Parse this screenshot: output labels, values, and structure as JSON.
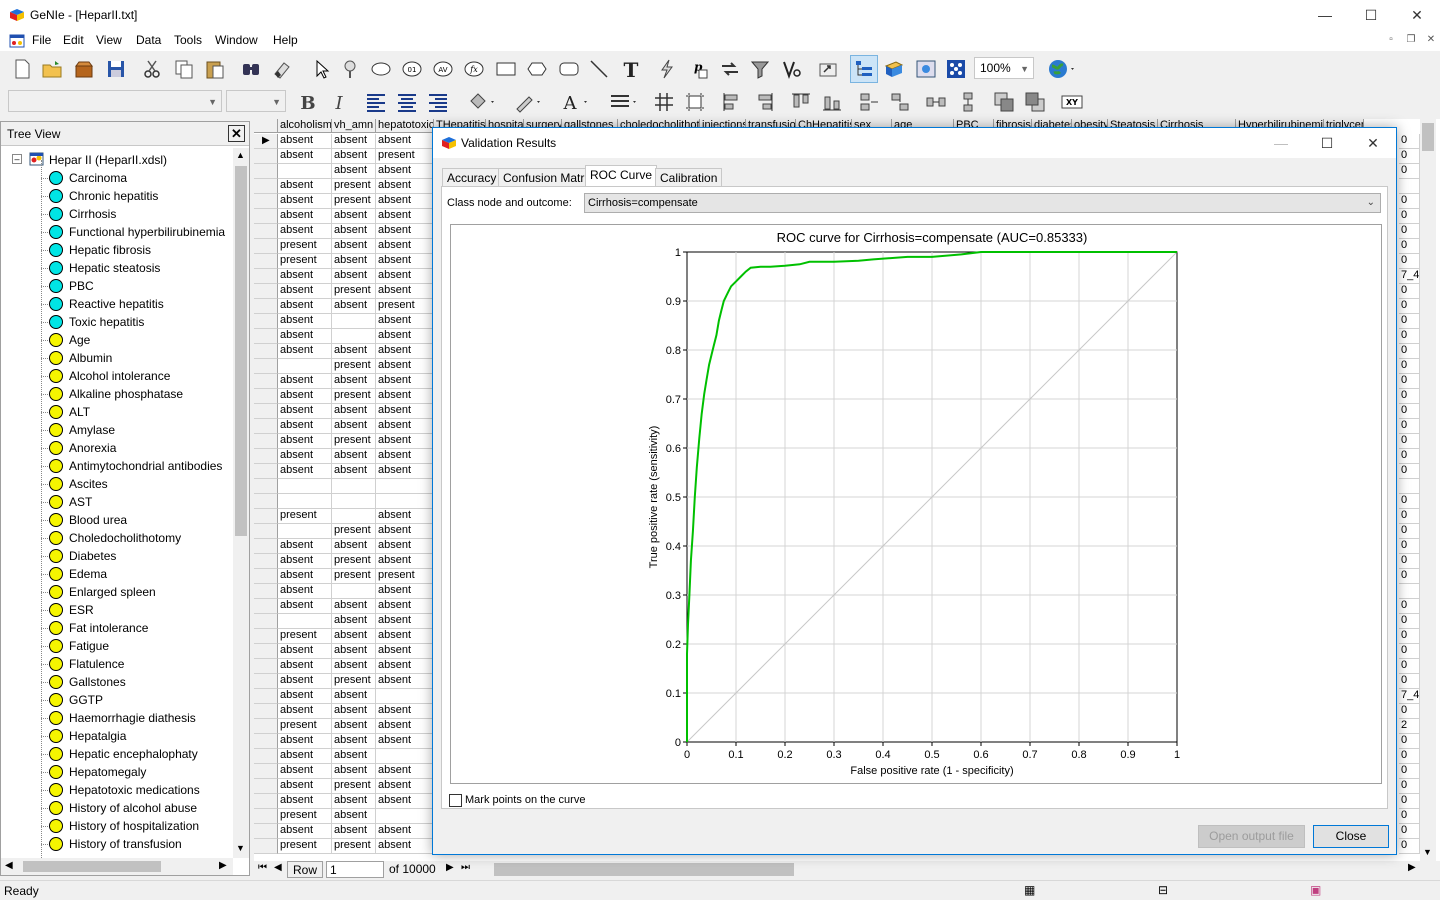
{
  "app": {
    "title": "GeNIe - [HeparII.txt]",
    "menu": [
      "File",
      "Edit",
      "View",
      "Data",
      "Tools",
      "Window",
      "Help"
    ],
    "zoom": "100%",
    "status": "Ready"
  },
  "tree": {
    "title": "Tree View",
    "root": "Hepar II (HeparII.xdsl)",
    "nodes": [
      {
        "label": "Carcinoma",
        "color": "#00e5e5"
      },
      {
        "label": "Chronic hepatitis",
        "color": "#00e5e5"
      },
      {
        "label": "Cirrhosis",
        "color": "#00e5e5"
      },
      {
        "label": "Functional hyperbilirubinemia",
        "color": "#00e5e5"
      },
      {
        "label": "Hepatic fibrosis",
        "color": "#00e5e5"
      },
      {
        "label": "Hepatic steatosis",
        "color": "#00e5e5"
      },
      {
        "label": "PBC",
        "color": "#00e5e5"
      },
      {
        "label": "Reactive hepatitis",
        "color": "#00e5e5"
      },
      {
        "label": "Toxic hepatitis",
        "color": "#00e5e5"
      },
      {
        "label": "Age",
        "color": "#f5f500"
      },
      {
        "label": "Albumin",
        "color": "#f5f500"
      },
      {
        "label": "Alcohol intolerance",
        "color": "#f5f500"
      },
      {
        "label": "Alkaline phosphatase",
        "color": "#f5f500"
      },
      {
        "label": "ALT",
        "color": "#f5f500"
      },
      {
        "label": "Amylase",
        "color": "#f5f500"
      },
      {
        "label": "Anorexia",
        "color": "#f5f500"
      },
      {
        "label": "Antimytochondrial antibodies",
        "color": "#f5f500"
      },
      {
        "label": "Ascites",
        "color": "#f5f500"
      },
      {
        "label": "AST",
        "color": "#f5f500"
      },
      {
        "label": "Blood urea",
        "color": "#f5f500"
      },
      {
        "label": "Choledocholithotomy",
        "color": "#f5f500"
      },
      {
        "label": "Diabetes",
        "color": "#f5f500"
      },
      {
        "label": "Edema",
        "color": "#f5f500"
      },
      {
        "label": "Enlarged spleen",
        "color": "#f5f500"
      },
      {
        "label": "ESR",
        "color": "#f5f500"
      },
      {
        "label": "Fat intolerance",
        "color": "#f5f500"
      },
      {
        "label": "Fatigue",
        "color": "#f5f500"
      },
      {
        "label": "Flatulence",
        "color": "#f5f500"
      },
      {
        "label": "Gallstones",
        "color": "#f5f500"
      },
      {
        "label": "GGTP",
        "color": "#f5f500"
      },
      {
        "label": "Haemorrhagie diathesis",
        "color": "#f5f500"
      },
      {
        "label": "Hepatalgia",
        "color": "#f5f500"
      },
      {
        "label": "Hepatic encephalophaty",
        "color": "#f5f500"
      },
      {
        "label": "Hepatomegaly",
        "color": "#f5f500"
      },
      {
        "label": "Hepatotoxic medications",
        "color": "#f5f500"
      },
      {
        "label": "History of alcohol abuse",
        "color": "#f5f500"
      },
      {
        "label": "History of hospitalization",
        "color": "#f5f500"
      },
      {
        "label": "History of transfusion",
        "color": "#f5f500"
      }
    ]
  },
  "grid": {
    "columns": [
      "alcoholism",
      "vh_amn",
      "hepatotoxic",
      "THepatitis",
      "hospital",
      "surgery",
      "gallstones",
      "choledocholithotomy",
      "injections",
      "transfusion",
      "ChHepatitis",
      "sex",
      "age",
      "PBC",
      "fibrosis",
      "diabetes",
      "obesity",
      "Steatosis",
      "Cirrhosis",
      "Hyperbilirubinemia",
      "triglyceri"
    ],
    "rows": [
      [
        "absent",
        "absent",
        "absent",
        "0"
      ],
      [
        "absent",
        "absent",
        "present",
        "0"
      ],
      [
        "",
        "absent",
        "absent",
        "0"
      ],
      [
        "absent",
        "present",
        "absent",
        ""
      ],
      [
        "absent",
        "present",
        "absent",
        "0"
      ],
      [
        "absent",
        "absent",
        "absent",
        "0"
      ],
      [
        "absent",
        "absent",
        "absent",
        "0"
      ],
      [
        "present",
        "absent",
        "absent",
        "0"
      ],
      [
        "present",
        "absent",
        "absent",
        "0"
      ],
      [
        "absent",
        "absent",
        "absent",
        "7_4"
      ],
      [
        "absent",
        "present",
        "absent",
        "0"
      ],
      [
        "absent",
        "absent",
        "present",
        "0"
      ],
      [
        "absent",
        "",
        "absent",
        "0"
      ],
      [
        "absent",
        "",
        "absent",
        "0"
      ],
      [
        "absent",
        "absent",
        "absent",
        "0"
      ],
      [
        "",
        "present",
        "absent",
        "0"
      ],
      [
        "absent",
        "absent",
        "absent",
        "0"
      ],
      [
        "absent",
        "present",
        "absent",
        "0"
      ],
      [
        "absent",
        "absent",
        "absent",
        "0"
      ],
      [
        "absent",
        "absent",
        "absent",
        "0"
      ],
      [
        "absent",
        "present",
        "absent",
        "0"
      ],
      [
        "absent",
        "absent",
        "absent",
        "0"
      ],
      [
        "absent",
        "absent",
        "absent",
        "0"
      ],
      [
        "",
        "",
        "",
        ""
      ],
      [
        "",
        "",
        "",
        "0"
      ],
      [
        "present",
        "",
        "absent",
        "0"
      ],
      [
        "",
        "present",
        "absent",
        "0"
      ],
      [
        "absent",
        "absent",
        "absent",
        "0"
      ],
      [
        "absent",
        "present",
        "absent",
        "0"
      ],
      [
        "absent",
        "present",
        "present",
        "0"
      ],
      [
        "absent",
        "",
        "absent",
        ""
      ],
      [
        "absent",
        "absent",
        "absent",
        "0"
      ],
      [
        "",
        "absent",
        "absent",
        "0"
      ],
      [
        "present",
        "absent",
        "absent",
        "0"
      ],
      [
        "absent",
        "absent",
        "absent",
        "0"
      ],
      [
        "absent",
        "absent",
        "absent",
        "0"
      ],
      [
        "absent",
        "present",
        "absent",
        "0"
      ],
      [
        "absent",
        "absent",
        "",
        "7_4"
      ],
      [
        "absent",
        "absent",
        "absent",
        "0"
      ],
      [
        "present",
        "absent",
        "absent",
        "2"
      ],
      [
        "absent",
        "absent",
        "absent",
        "0"
      ],
      [
        "absent",
        "absent",
        "",
        "0"
      ],
      [
        "absent",
        "absent",
        "absent",
        "0"
      ],
      [
        "absent",
        "present",
        "absent",
        "0"
      ],
      [
        "absent",
        "absent",
        "absent",
        "0"
      ],
      [
        "present",
        "absent",
        "",
        "0"
      ],
      [
        "absent",
        "absent",
        "absent",
        "0"
      ],
      [
        "present",
        "present",
        "absent",
        "0"
      ]
    ],
    "nav": {
      "label": "Row",
      "current": "1",
      "total": "of 10000"
    }
  },
  "dialog": {
    "title": "Validation Results",
    "tabs": [
      "Accuracy",
      "Confusion Matrix",
      "ROC Curve",
      "Calibration"
    ],
    "active_tab": 2,
    "class_label": "Class node and outcome:",
    "class_value": "Cirrhosis=compensate",
    "mark_points_label": "Mark points on the curve",
    "mark_points_checked": false,
    "open_output_label": "Open output file",
    "close_label": "Close"
  },
  "chart_data": {
    "type": "line",
    "title": "ROC curve for Cirrhosis=compensate (AUC=0.85333)",
    "xlabel": "False positive rate (1 - specificity)",
    "ylabel": "True positive rate (sensitivity)",
    "xlim": [
      0,
      1
    ],
    "ylim": [
      0,
      1
    ],
    "ticks": [
      "0",
      "0.1",
      "0.2",
      "0.3",
      "0.4",
      "0.5",
      "0.6",
      "0.7",
      "0.8",
      "0.9",
      "1"
    ],
    "grid": true,
    "diagonal": true,
    "series": [
      {
        "color": "#00c000",
        "x": [
          0,
          0,
          0.002,
          0.005,
          0.008,
          0.012,
          0.016,
          0.02,
          0.025,
          0.03,
          0.035,
          0.04,
          0.045,
          0.05,
          0.055,
          0.06,
          0.065,
          0.07,
          0.075,
          0.08,
          0.085,
          0.09,
          0.1,
          0.11,
          0.12,
          0.13,
          0.15,
          0.17,
          0.2,
          0.23,
          0.25,
          0.3,
          0.35,
          0.38,
          0.45,
          0.5,
          0.56,
          0.6,
          0.7,
          0.8,
          0.9,
          1.0
        ],
        "y": [
          0,
          0.18,
          0.24,
          0.3,
          0.37,
          0.43,
          0.5,
          0.56,
          0.62,
          0.67,
          0.71,
          0.74,
          0.77,
          0.79,
          0.81,
          0.83,
          0.86,
          0.88,
          0.9,
          0.91,
          0.92,
          0.93,
          0.94,
          0.95,
          0.96,
          0.968,
          0.97,
          0.97,
          0.972,
          0.975,
          0.98,
          0.98,
          0.982,
          0.985,
          0.99,
          0.99,
          0.995,
          1,
          1,
          1,
          1,
          1
        ]
      }
    ]
  }
}
